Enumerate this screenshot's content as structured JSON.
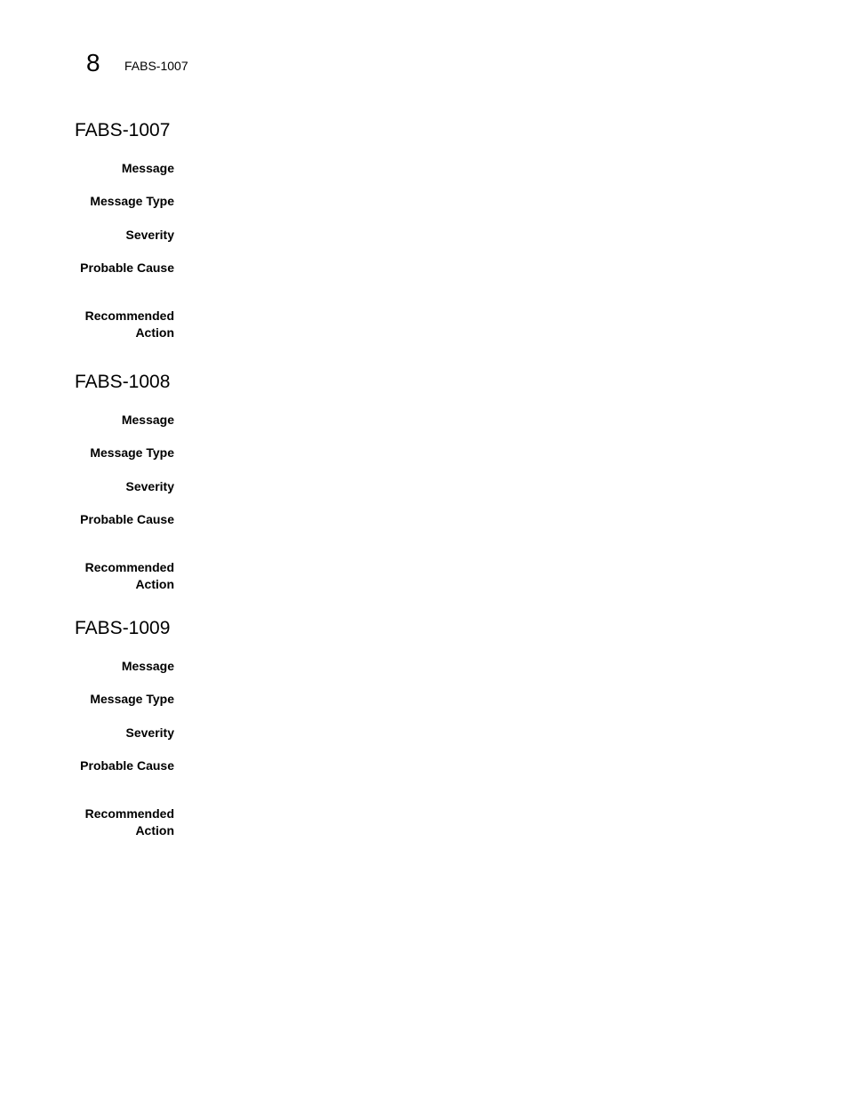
{
  "header": {
    "chapter_number": "8",
    "running_title": "FABS-1007"
  },
  "sections": [
    {
      "title": "FABS-1007",
      "fields": [
        {
          "label": "Message",
          "value": ""
        },
        {
          "label": "Message Type",
          "value": ""
        },
        {
          "label": "Severity",
          "value": ""
        },
        {
          "label": "Probable Cause",
          "value": ""
        },
        {
          "label": "Recommended Action",
          "label_lines": [
            "Recommended",
            "Action"
          ],
          "value": ""
        }
      ]
    },
    {
      "title": "FABS-1008",
      "fields": [
        {
          "label": "Message",
          "value": ""
        },
        {
          "label": "Message Type",
          "value": ""
        },
        {
          "label": "Severity",
          "value": ""
        },
        {
          "label": "Probable Cause",
          "value": ""
        },
        {
          "label": "Recommended Action",
          "label_lines": [
            "Recommended",
            "Action"
          ],
          "value": ""
        }
      ]
    },
    {
      "title": "FABS-1009",
      "fields": [
        {
          "label": "Message",
          "value": ""
        },
        {
          "label": "Message Type",
          "value": ""
        },
        {
          "label": "Severity",
          "value": ""
        },
        {
          "label": "Probable Cause",
          "value": ""
        },
        {
          "label": "Recommended Action",
          "label_lines": [
            "Recommended",
            "Action"
          ],
          "value": ""
        }
      ]
    }
  ]
}
